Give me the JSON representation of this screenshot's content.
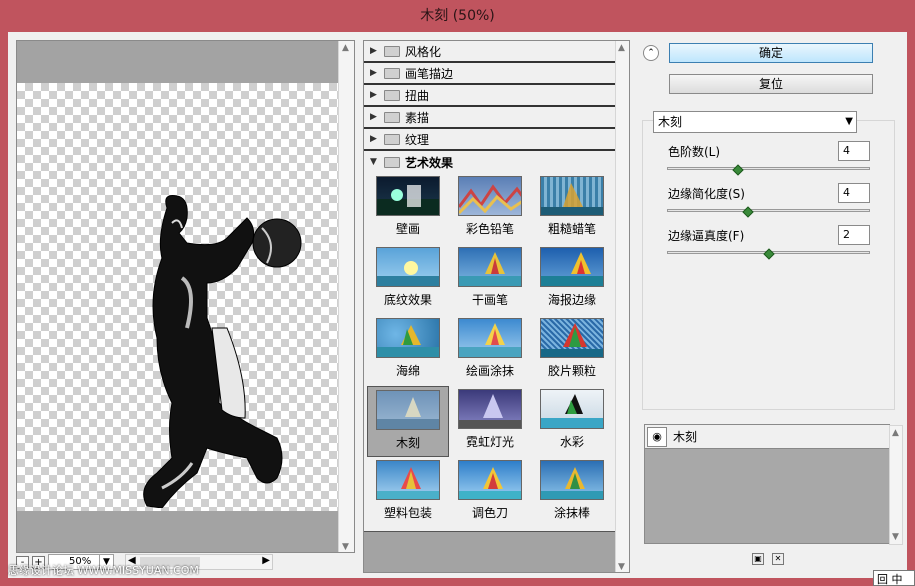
{
  "window": {
    "title": "木刻 (50%)"
  },
  "preview": {
    "zoom": "50%",
    "zoom_out_label": "-",
    "zoom_in_label": "+"
  },
  "gallery": {
    "categories": [
      {
        "label": "风格化"
      },
      {
        "label": "画笔描边"
      },
      {
        "label": "扭曲"
      },
      {
        "label": "素描"
      },
      {
        "label": "纹理"
      },
      {
        "label": "艺术效果"
      }
    ],
    "filters": [
      {
        "label": "壁画"
      },
      {
        "label": "彩色铅笔"
      },
      {
        "label": "粗糙蜡笔"
      },
      {
        "label": "底纹效果"
      },
      {
        "label": "干画笔"
      },
      {
        "label": "海报边缘"
      },
      {
        "label": "海绵"
      },
      {
        "label": "绘画涂抹"
      },
      {
        "label": "胶片颗粒"
      },
      {
        "label": "木刻"
      },
      {
        "label": "霓虹灯光"
      },
      {
        "label": "水彩"
      },
      {
        "label": "塑料包装"
      },
      {
        "label": "调色刀"
      },
      {
        "label": "涂抹棒"
      }
    ],
    "selected": "木刻"
  },
  "actions": {
    "ok_label": "确定",
    "reset_label": "复位"
  },
  "settings": {
    "filter_select": "木刻",
    "params": [
      {
        "label": "色阶数(L)",
        "value": "4",
        "fraction": 0.35
      },
      {
        "label": "边缘简化度(S)",
        "value": "4",
        "fraction": 0.4
      },
      {
        "label": "边缘逼真度(F)",
        "value": "2",
        "fraction": 0.5
      }
    ]
  },
  "layers": {
    "items": [
      {
        "label": "木刻"
      }
    ]
  },
  "watermark": "思缘设计论坛 WWW.MISSYUAN.COM",
  "corner_badge": "回 中"
}
